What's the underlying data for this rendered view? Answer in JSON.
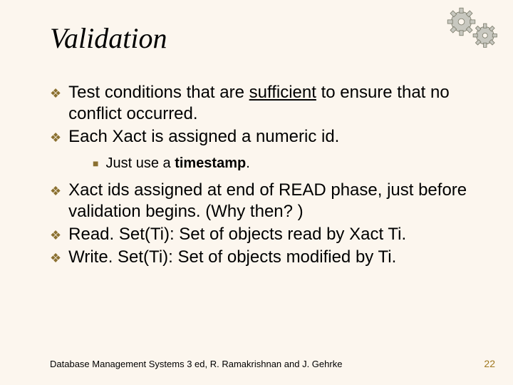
{
  "title": "Validation",
  "bullets": {
    "b1_pre": "Test conditions that are ",
    "b1_em": "sufficient",
    "b1_post": " to ensure that no conflict occurred.",
    "b2": "Each Xact is assigned a numeric id.",
    "sub_pre": "Just use a ",
    "sub_em": "timestamp",
    "sub_post": ".",
    "b3": "Xact ids assigned at end of READ phase, just before validation begins.  (Why then? )",
    "b4": "Read. Set(Ti):  Set of objects read by Xact Ti.",
    "b5": "Write. Set(Ti):  Set of objects modified by Ti."
  },
  "footer": "Database Management Systems 3 ed,  R. Ramakrishnan and J. Gehrke",
  "page": "22"
}
